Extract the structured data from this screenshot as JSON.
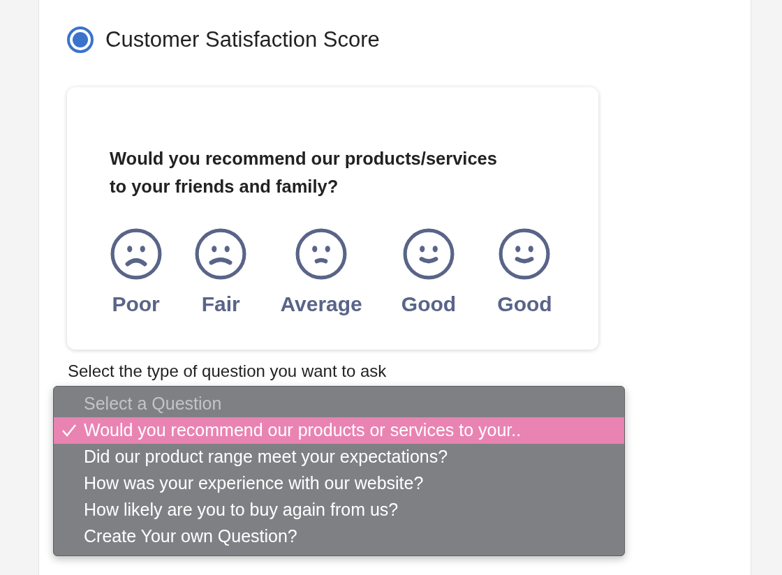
{
  "option": {
    "label": "Customer Satisfaction Score",
    "selected": true
  },
  "preview": {
    "question": "Would you recommend our products/services to your friends and family?",
    "ratings": [
      {
        "label": "Poor",
        "kind": "frown"
      },
      {
        "label": "Fair",
        "kind": "sad"
      },
      {
        "label": "Average",
        "kind": "neutral"
      },
      {
        "label": "Good",
        "kind": "smile"
      },
      {
        "label": "Good",
        "kind": "smile"
      }
    ]
  },
  "question_type": {
    "label": "Select the type of question you want to ask",
    "menu": [
      {
        "text": "Select a Question",
        "disabled": true,
        "selected": false
      },
      {
        "text": "Would you recommend our products or services to your..",
        "disabled": false,
        "selected": true
      },
      {
        "text": "Did our product range meet your expectations?",
        "disabled": false,
        "selected": false
      },
      {
        "text": "How was your experience with our website?",
        "disabled": false,
        "selected": false
      },
      {
        "text": "How likely are you to buy again from us?",
        "disabled": false,
        "selected": false
      },
      {
        "text": "Create Your own Question?",
        "disabled": false,
        "selected": false
      }
    ]
  }
}
